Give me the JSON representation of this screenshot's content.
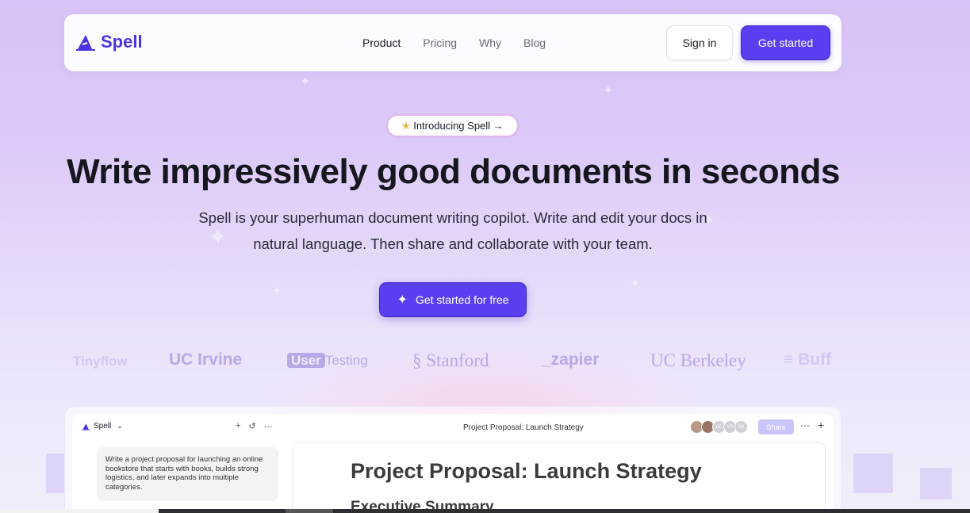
{
  "nav": {
    "brand": "Spell",
    "links": [
      "Product",
      "Pricing",
      "Why",
      "Blog"
    ],
    "sign_in": "Sign in",
    "get_started": "Get started"
  },
  "hero": {
    "pill": "Introducing Spell →",
    "headline": "Write impressively good documents in seconds",
    "subline": "Spell is your superhuman document writing copilot. Write and edit your docs in natural language. Then share and collaborate with your team.",
    "cta": "Get started for free"
  },
  "brands": [
    "Tinyflow",
    "UC Irvine",
    "User",
    "Testing",
    "Stanford",
    "_zapier",
    "UC Berkeley",
    "Buff"
  ],
  "preview": {
    "app_name": "Spell",
    "prompt": "Write a project proposal for launching an online bookstore that starts with books, builds strong logistics, and later expands into multiple categories.",
    "doc_tab_title": "Project Proposal: Launch Strategy",
    "avatars": [
      "",
      "",
      "LE",
      "VP",
      "SK"
    ],
    "share": "Share",
    "doc_heading": "Project Proposal: Launch Strategy",
    "doc_subheading": "Executive Summary"
  },
  "colors": {
    "accent": "#5a3ff0",
    "brand_text": "#4a34e0",
    "logo_muted": "#b8a8e6"
  }
}
